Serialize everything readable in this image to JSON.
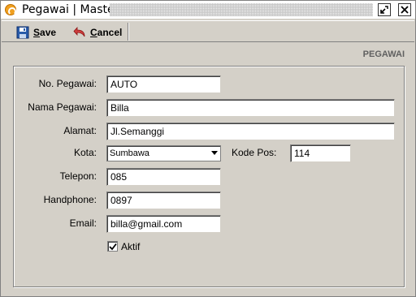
{
  "window": {
    "title": "Pegawai | Master",
    "app_icon": "app-logo-icon",
    "restore_icon": "restore-icon",
    "close_icon": "close-icon"
  },
  "toolbar": {
    "save_label": "Save",
    "save_icon": "floppy-disk-icon",
    "cancel_label": "Cancel",
    "cancel_icon": "undo-arrow-icon"
  },
  "section_label": "PEGAWAI",
  "form": {
    "no_pegawai": {
      "label": "No. Pegawai:",
      "value": "AUTO"
    },
    "nama_pegawai": {
      "label": "Nama Pegawai:",
      "value": "Billa"
    },
    "alamat": {
      "label": "Alamat:",
      "value": "Jl.Semanggi"
    },
    "kota": {
      "label": "Kota:",
      "value": "Sumbawa"
    },
    "kode_pos": {
      "label": "Kode Pos:",
      "value": "114"
    },
    "telepon": {
      "label": "Telepon:",
      "value": "085"
    },
    "handphone": {
      "label": "Handphone:",
      "value": "0897"
    },
    "email": {
      "label": "Email:",
      "value": "billa@gmail.com"
    },
    "aktif": {
      "label": "Aktif",
      "checked": true
    }
  }
}
